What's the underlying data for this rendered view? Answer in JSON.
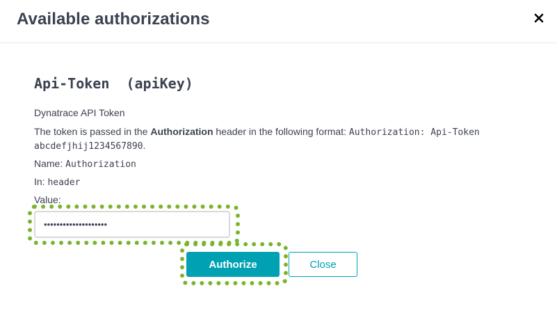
{
  "dialog": {
    "title": "Available authorizations",
    "close_icon": "close-icon"
  },
  "auth": {
    "section_title": "Api-Token  (apiKey)",
    "description": "Dynatrace API Token",
    "format_text_prefix": "The token is passed in the ",
    "format_text_bold": "Authorization",
    "format_text_middle": " header in the following format: ",
    "format_code": "Authorization: Api-Token",
    "format_code_line2": "abcdefjhij1234567890",
    "format_text_end": ".",
    "name_label": "Name: ",
    "name_value": "Authorization",
    "in_label": "In: ",
    "in_value": "header",
    "value_label": "Value:",
    "value_input": "••••••••••••••••••••"
  },
  "buttons": {
    "authorize_label": "Authorize",
    "close_label": "Close"
  },
  "colors": {
    "accent": "#00a1b2",
    "highlight": "#7ab42c"
  }
}
